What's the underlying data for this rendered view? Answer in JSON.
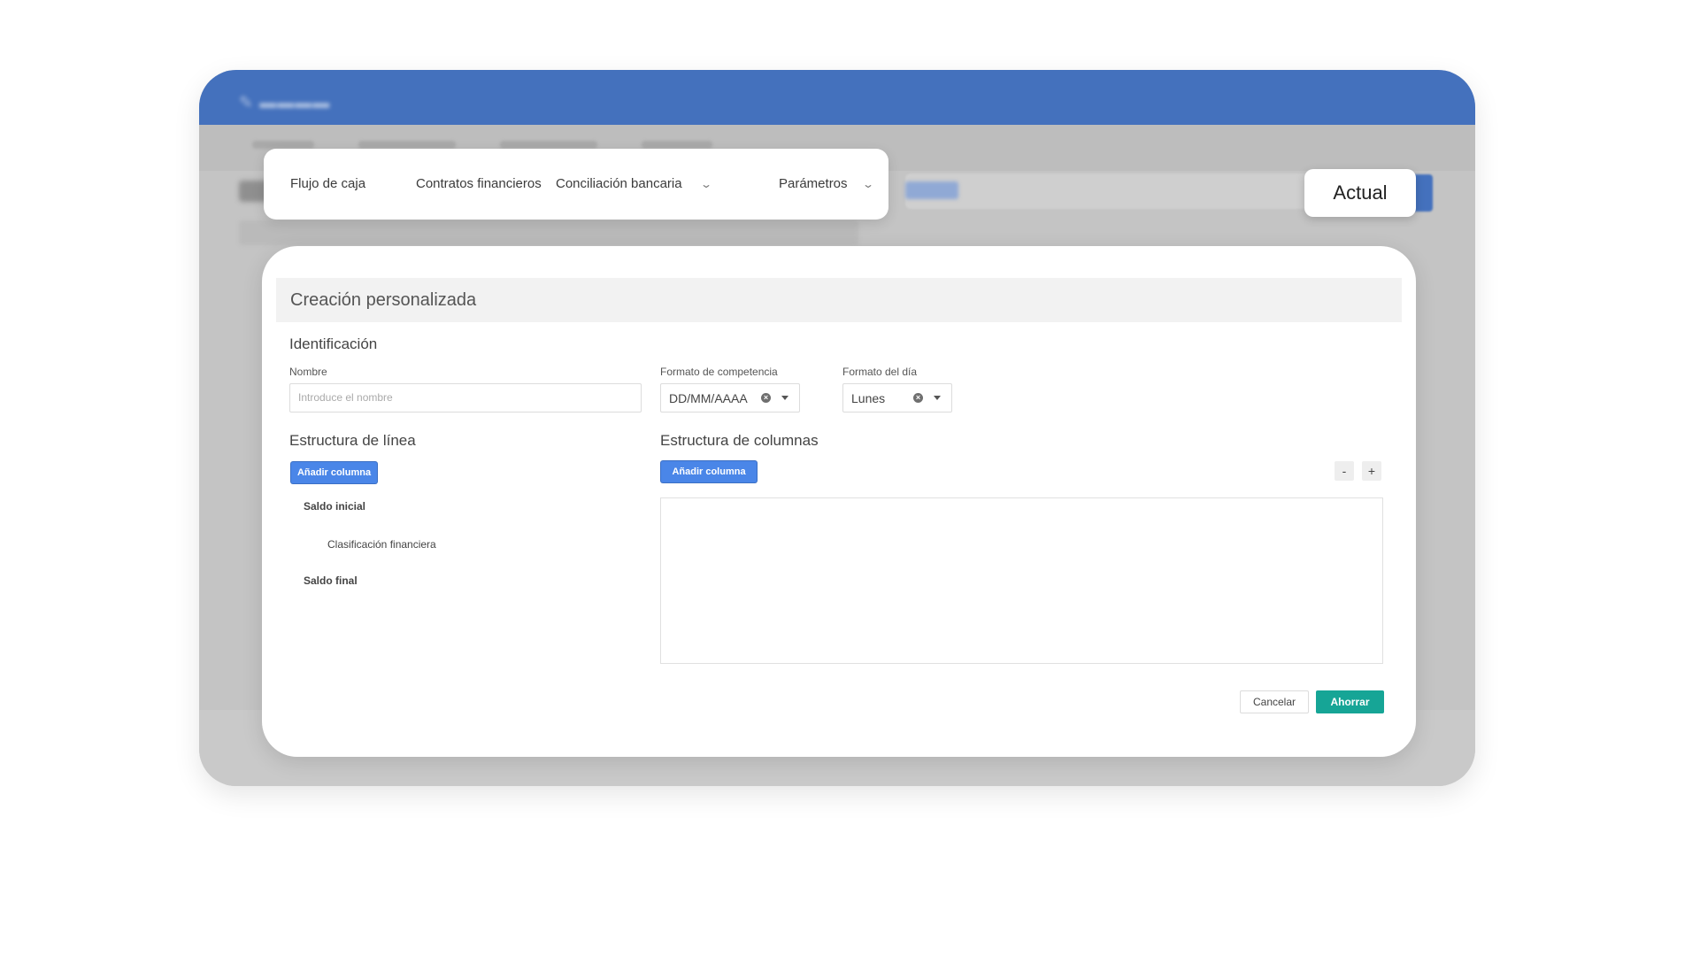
{
  "nav": {
    "items": [
      {
        "label": "Flujo de caja",
        "has_dropdown": false
      },
      {
        "label": "Contratos financieros",
        "has_dropdown": false
      },
      {
        "label": "Conciliación bancaria",
        "has_dropdown": true
      },
      {
        "label": "Parámetros",
        "has_dropdown": true
      }
    ]
  },
  "badge": {
    "label": "Actual"
  },
  "modal": {
    "title": "Creación personalizada",
    "identification": {
      "section_label": "Identificación",
      "name_label": "Nombre",
      "name_placeholder": "Introduce el nombre",
      "competence_label": "Formato de competencia",
      "competence_value": "DD/MM/AAAA",
      "day_label": "Formato del día",
      "day_value": "Lunes"
    },
    "line_structure": {
      "section_label": "Estructura de línea",
      "add_button": "Añadir columna",
      "items": [
        "Saldo inicial",
        "Clasificación financiera",
        "Saldo final"
      ]
    },
    "column_structure": {
      "section_label": "Estructura de columnas",
      "add_button": "Añadir columna",
      "zoom_out": "-",
      "zoom_in": "+"
    },
    "footer": {
      "cancel": "Cancelar",
      "save": "Ahorrar"
    }
  },
  "colors": {
    "topbar": "#4471bd",
    "primary_button": "#4a86e8",
    "save_button": "#16a596"
  }
}
